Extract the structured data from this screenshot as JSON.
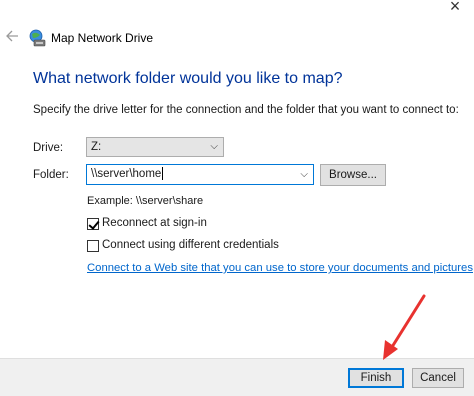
{
  "window": {
    "title": "Map Network Drive",
    "close_glyph": "×",
    "back_icon": "back-arrow-icon",
    "app_icon": "network-drive-icon"
  },
  "heading": "What network folder would you like to map?",
  "instruction": "Specify the drive letter for the connection and the folder that you want to connect to:",
  "drive": {
    "label": "Drive:",
    "value": "Z:"
  },
  "folder": {
    "label": "Folder:",
    "value": "\\\\server\\home",
    "browse_label": "Browse..."
  },
  "example": "Example: \\\\server\\share",
  "reconnect": {
    "label": "Reconnect at sign-in",
    "checked": true
  },
  "credentials": {
    "label": "Connect using different credentials",
    "checked": false
  },
  "link_text": "Connect to a Web site that you can use to store your documents and pictures",
  "buttons": {
    "finish": "Finish",
    "cancel": "Cancel"
  },
  "colors": {
    "heading": "#003399",
    "link": "#0066cc",
    "focus_border": "#0078d7",
    "annotation_arrow": "#e8322f"
  }
}
